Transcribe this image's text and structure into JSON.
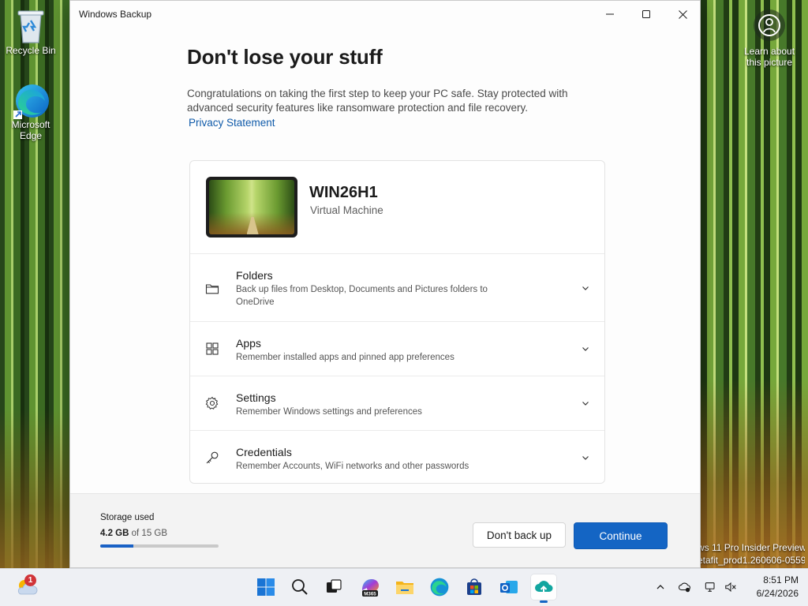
{
  "desktop": {
    "icons": [
      {
        "label": "Recycle Bin"
      },
      {
        "label": "Microsoft Edge"
      }
    ],
    "learn_picture": "Learn about this picture",
    "watermark": [
      "ws 11 Pro Insider Preview",
      "etafit_prod1.260606-0559"
    ]
  },
  "window": {
    "title": "Windows Backup",
    "heading": "Don't lose your stuff",
    "intro": "Congratulations on taking the first step to keep your PC safe. Stay protected with advanced security features like ransomware protection and file recovery.",
    "privacy_link": "Privacy Statement",
    "device": {
      "name": "WIN26H1",
      "type": "Virtual Machine"
    },
    "sections": [
      {
        "icon": "folder-icon",
        "title": "Folders",
        "description": "Back up files from Desktop, Documents and Pictures folders to OneDrive"
      },
      {
        "icon": "apps-icon",
        "title": "Apps",
        "description": "Remember installed apps and pinned app preferences"
      },
      {
        "icon": "gear-icon",
        "title": "Settings",
        "description": "Remember Windows settings and preferences"
      },
      {
        "icon": "key-icon",
        "title": "Credentials",
        "description": "Remember Accounts, WiFi networks and other passwords"
      }
    ],
    "storage": {
      "label": "Storage used",
      "used": "4.2 GB",
      "total": "of 15 GB",
      "fraction": 0.28
    },
    "buttons": {
      "secondary": "Don't back up",
      "primary": "Continue"
    }
  },
  "taskbar": {
    "weather_badge": "1",
    "apps": [
      "start-icon",
      "search-icon",
      "task-view-icon",
      "m365-copilot-icon",
      "file-explorer-icon",
      "edge-icon",
      "store-icon",
      "outlook-icon",
      "windows-backup-icon"
    ],
    "m365_label": "M365",
    "clock": {
      "time": "8:51 PM",
      "date": "6/24/2026"
    }
  },
  "colors": {
    "accent": "#1465c4",
    "link": "#0f5aa9"
  }
}
